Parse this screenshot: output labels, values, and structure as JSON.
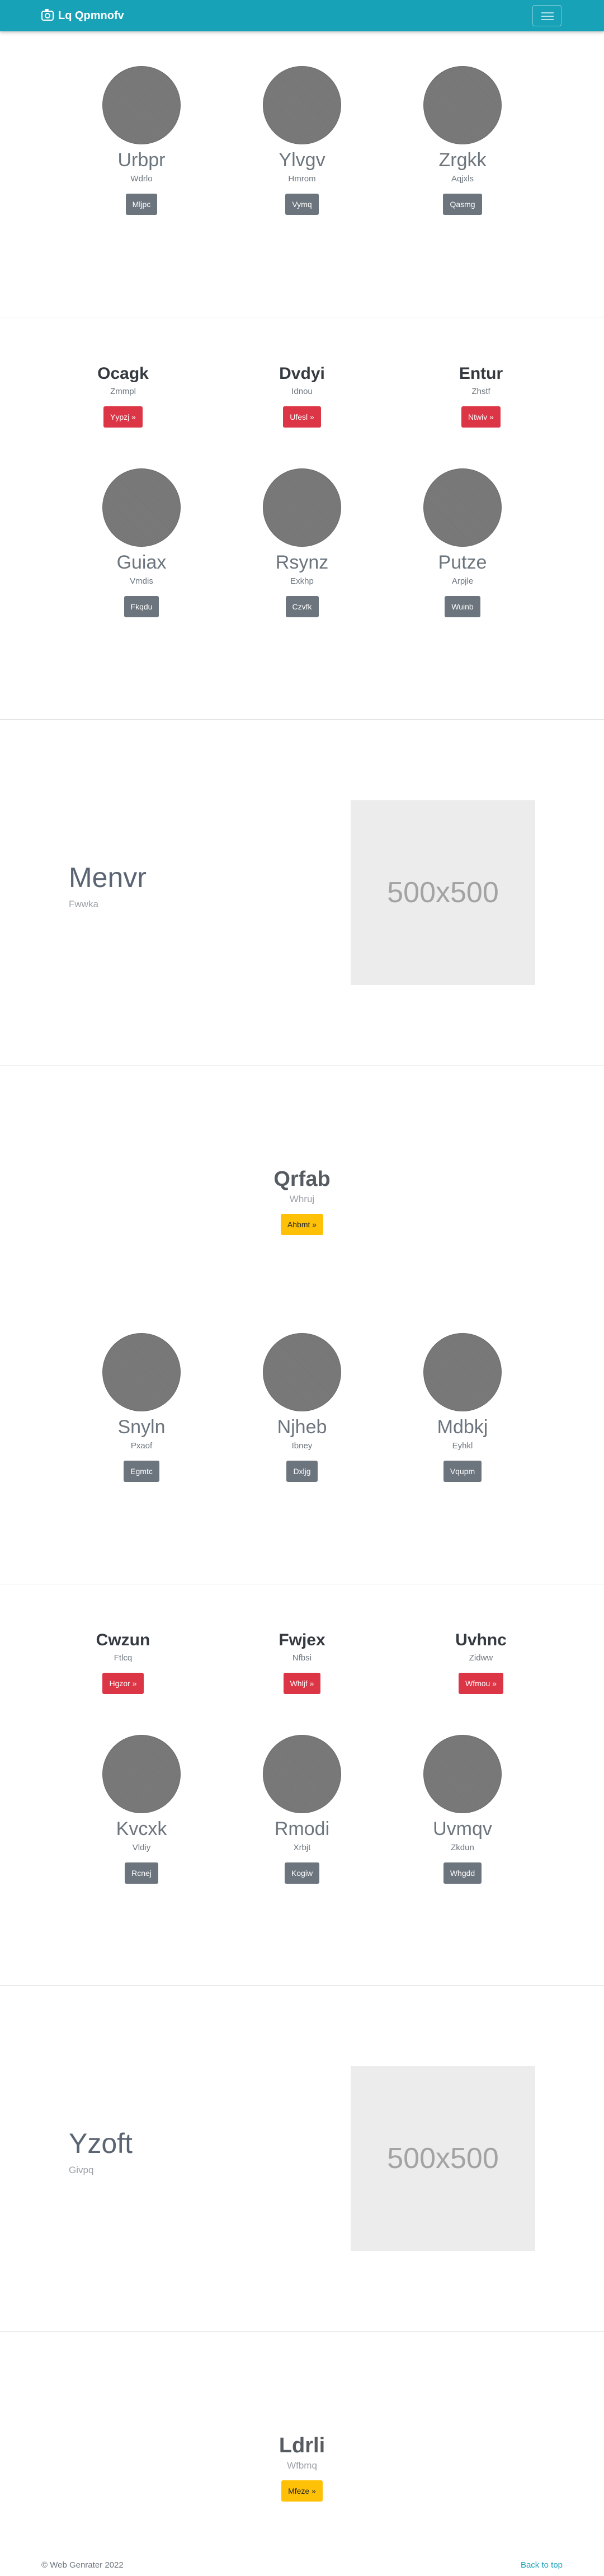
{
  "navbar": {
    "brand": "Lq Qpmnofv",
    "brand_icon": "camera-icon",
    "menu_icon": "hamburger-icon",
    "bg_color": "#17a2b8"
  },
  "section1": {
    "profiles": [
      {
        "name": "Urbpr",
        "sub": "Wdrlo",
        "button": "Mljpc"
      },
      {
        "name": "Ylvgv",
        "sub": "Hmrom",
        "button": "Vymq"
      },
      {
        "name": "Zrgkk",
        "sub": "Aqjxls",
        "button": "Qasmg"
      }
    ]
  },
  "section2": {
    "features": [
      {
        "title": "Ocagk",
        "sub": "Zmmpl",
        "button": "Yypzj »"
      },
      {
        "title": "Dvdyi",
        "sub": "Idnou",
        "button": "Ufesl »"
      },
      {
        "title": "Entur",
        "sub": "Zhstf",
        "button": "Ntwiv »"
      }
    ],
    "profiles": [
      {
        "name": "Guiax",
        "sub": "Vmdis",
        "button": "Fkqdu"
      },
      {
        "name": "Rsynz",
        "sub": "Exkhp",
        "button": "Czvfk"
      },
      {
        "name": "Putze",
        "sub": "Arpjle",
        "button": "Wuinb"
      }
    ]
  },
  "hero1": {
    "title": "Menvr",
    "sub": "Fwwka",
    "placeholder": "500x500"
  },
  "lead1": {
    "title": "Qrfab",
    "sub": "Whruj",
    "button": "Ahbmt »"
  },
  "section3": {
    "profiles": [
      {
        "name": "Snyln",
        "sub": "Pxaof",
        "button": "Egmtc"
      },
      {
        "name": "Njheb",
        "sub": "Ibney",
        "button": "Dxljg"
      },
      {
        "name": "Mdbkj",
        "sub": "Eyhkl",
        "button": "Vqupm"
      }
    ]
  },
  "section4": {
    "features": [
      {
        "title": "Cwzun",
        "sub": "Ftlcq",
        "button": "Hgzor »"
      },
      {
        "title": "Fwjex",
        "sub": "Nfbsi",
        "button": "Whljf »"
      },
      {
        "title": "Uvhnc",
        "sub": "Zidww",
        "button": "Wfmou »"
      }
    ],
    "profiles": [
      {
        "name": "Kvcxk",
        "sub": "Vldiy",
        "button": "Rcnej"
      },
      {
        "name": "Rmodi",
        "sub": "Xrbjt",
        "button": "Kogiw"
      },
      {
        "name": "Uvmqv",
        "sub": "Zkdun",
        "button": "Whgdd"
      }
    ]
  },
  "hero2": {
    "title": "Yzoft",
    "sub": "Givpq",
    "placeholder": "500x500"
  },
  "lead2": {
    "title": "Ldrli",
    "sub": "Wfbmq",
    "button": "Mfeze »"
  },
  "footer": {
    "copyright": "© Web Genrater 2022",
    "back_to_top": "Back to top"
  }
}
